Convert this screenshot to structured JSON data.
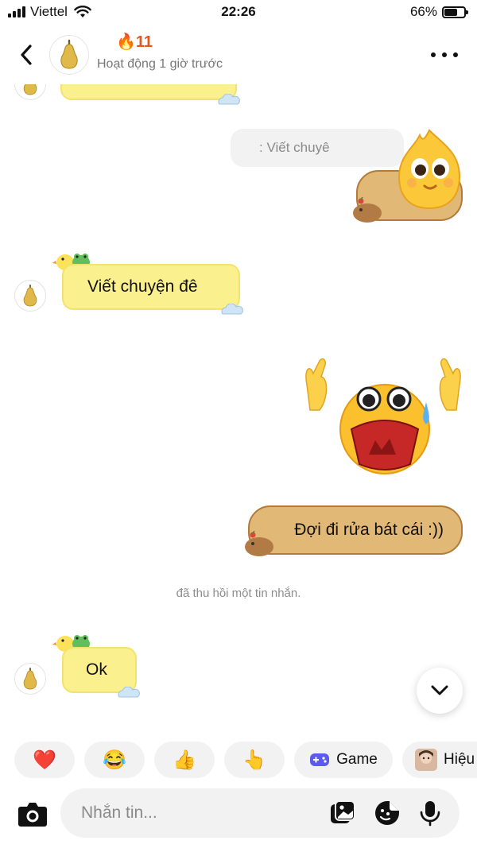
{
  "status_bar": {
    "carrier": "Viettel",
    "time": "22:26",
    "battery": "66%",
    "battery_level": 0.66
  },
  "header": {
    "contact_name": "🔥11",
    "activity": "Hoạt động 1 giờ trước"
  },
  "messages": {
    "reply_preview": ": Viết chuyê",
    "incoming_1": "Viết chuyện đê",
    "outgoing_1": "Đợi đi rửa bát cái :))",
    "recall_note": "đã thu hồi một tin nhắn.",
    "incoming_2": "Ok"
  },
  "quick_reactions": {
    "heart": "❤️",
    "laugh": "😂",
    "thumbs": "👍",
    "point": "👆",
    "game_label": "Game",
    "hieu_label": "Hiệu"
  },
  "composer": {
    "placeholder": "Nhắn tin..."
  },
  "colors": {
    "yellow_bubble": "#fbf08e",
    "brown_bubble": "#e2b877",
    "accent_orange": "#e8541e",
    "game_purple": "#5b5bf0"
  },
  "icons": [
    "back-arrow-icon",
    "more-dots-icon",
    "pear-avatar-icon",
    "chevron-down-icon",
    "camera-icon",
    "image-icon",
    "sticker-icon",
    "microphone-icon",
    "game-controller-icon"
  ]
}
